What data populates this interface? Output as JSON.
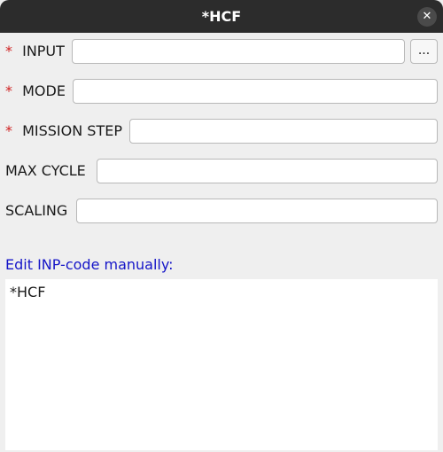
{
  "window": {
    "title": "*HCF",
    "close_glyph": "✕"
  },
  "fields": {
    "input": {
      "label": "INPUT",
      "required_mark": "*",
      "value": "",
      "browse_label": "..."
    },
    "mode": {
      "label": "MODE",
      "required_mark": "*",
      "value": ""
    },
    "mission_step": {
      "label": "MISSION STEP",
      "required_mark": "*",
      "value": ""
    },
    "max_cycle": {
      "label": "MAX CYCLE",
      "value": ""
    },
    "scaling": {
      "label": "SCALING",
      "value": ""
    }
  },
  "editor": {
    "label": "Edit INP-code manually:",
    "content": "*HCF"
  },
  "colors": {
    "titlebar": "#2c2c2c",
    "background": "#efefef",
    "required_mark": "#d02020",
    "editor_label": "#1515c8"
  },
  "icons": {
    "close": "close-icon"
  }
}
